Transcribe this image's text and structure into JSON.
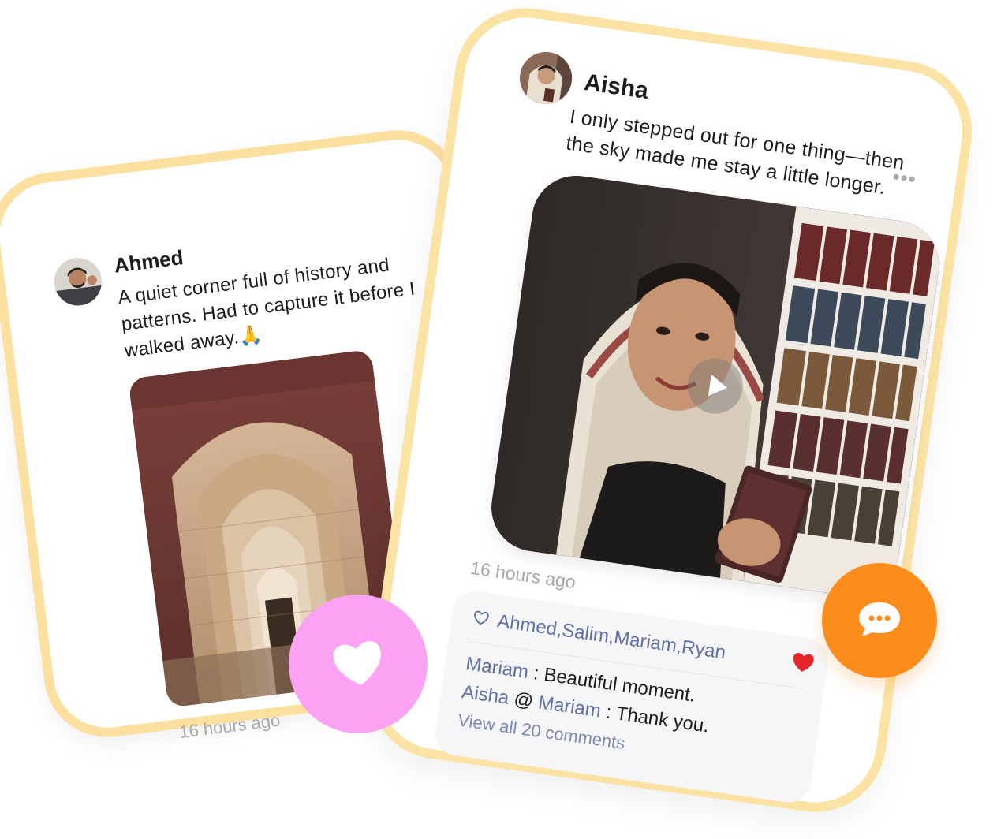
{
  "posts": [
    {
      "author": "Ahmed",
      "caption": "A quiet corner full of history and patterns. Had to capture it before I walked away.🙏",
      "time": "16 hours ago",
      "photo": "ornate-arched-corridor"
    },
    {
      "author": "Aisha",
      "caption": "I only stepped out for one thing—then the sky made me stay a little longer.",
      "time": "16 hours ago",
      "more_label": "•••",
      "photo": "woman-with-book-video",
      "likes": {
        "icon": "heart-outline-icon",
        "names": "Ahmed,Salim,Mariam,Ryan"
      },
      "comments": [
        {
          "author": "Mariam",
          "sep": " : ",
          "text": "Beautiful moment."
        },
        {
          "author": "Aisha",
          "mention_prefix": " @ ",
          "mention": "Mariam",
          "sep": " : ",
          "text": "Thank you."
        }
      ],
      "view_all": "View all 20 comments"
    }
  ],
  "colors": {
    "card_border": "#fbe0a0",
    "like_fab": "#fca2f3",
    "comment_fab": "#fb8d1c",
    "name_blue": "#5e6fa8",
    "heart_red": "#e5242b"
  }
}
